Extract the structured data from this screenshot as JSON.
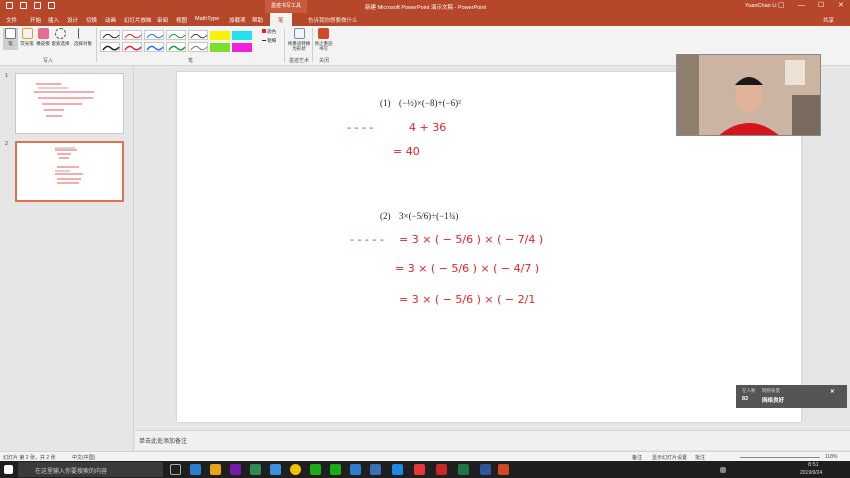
{
  "titlebar": {
    "context_tab": "墨迹书写工具",
    "doc_title": "新建 Microsoft PowerPoint 演示文稿 - PowerPoint",
    "user": "YuanChao Li",
    "restore_label": "▢",
    "minimize_label": "—",
    "max_label": "☐",
    "close_label": "✕"
  },
  "tabs": [
    "文件",
    "开始",
    "插入",
    "设计",
    "切换",
    "动画",
    "幻灯片放映",
    "审阅",
    "视图",
    "MathType",
    "加载项",
    "帮助",
    "笔"
  ],
  "active_tab": "笔",
  "tell_me": "告诉我你想要做什么",
  "share": "共享",
  "ribbon": {
    "write_group": {
      "buttons": [
        "笔",
        "荧光笔",
        "橡皮擦",
        "套索选择",
        "选择对象"
      ],
      "label": "写入"
    },
    "pens_group": {
      "label": "笔"
    },
    "color_label": "颜色",
    "thickness_label": "粗细",
    "ink_to_shape": "将墨迹转换为形状",
    "ink_art_label": "墨迹艺术",
    "stop_ink": "停止墨迹书写",
    "close_group_label": "关闭"
  },
  "thumbnails": [
    {
      "num": "1",
      "selected": false
    },
    {
      "num": "2",
      "selected": true
    }
  ],
  "slide": {
    "p1_label": "(1)",
    "p2_label": "(2)",
    "ink_color": "#e8202a",
    "p1_line1": "4 + 36",
    "p1_line2": "= 40",
    "p2_line1": "= 3 × ( − 5/6 ) × ( − 7/4 )",
    "p2_line2": "= 3 × ( − 5/6 ) × ( − 4/7 )",
    "p2_line3": "= 3 × ( − 5/6 ) × ( − 2/1"
  },
  "notes_placeholder": "单击此处添加备注",
  "status": {
    "slide_info": "幻灯片 第 2 张，共 2 张",
    "language": "中文(中国)",
    "notes": "备注",
    "comments": "显示幻灯片设置",
    "comments2": "批注",
    "zoom": "118%"
  },
  "toast": {
    "online_label": "在人数",
    "online_value": "83",
    "network_label": "网络质量",
    "network_value": "网络良好",
    "close_label": "✕"
  },
  "taskbar": {
    "search_placeholder": "在这里输入你要搜索的内容",
    "time": "8:51",
    "date": "2019/9/24"
  }
}
